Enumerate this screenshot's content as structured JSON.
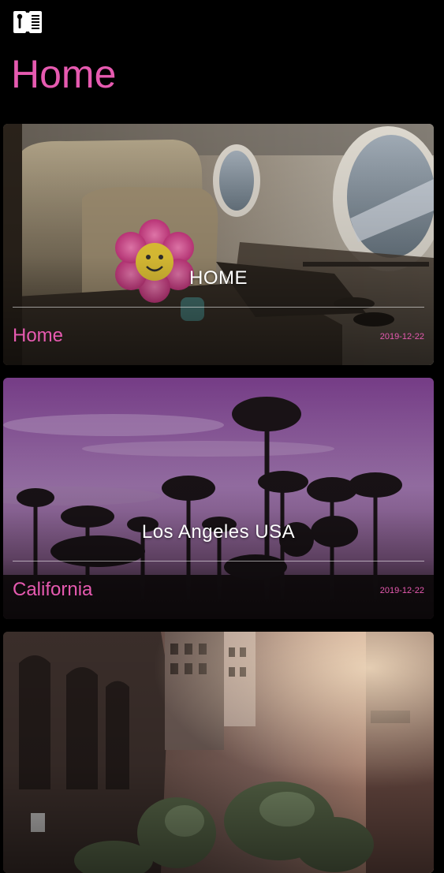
{
  "theme": {
    "accent": "#e65ab0",
    "background": "#000000"
  },
  "top_bar": {
    "menu_icon": "book-menu-icon"
  },
  "page": {
    "title": "Home"
  },
  "cards": [
    {
      "headline": "HOME",
      "category": "Home",
      "date": "2019-12-22",
      "image": "airplane-cabin-seat-with-flower-toy"
    },
    {
      "headline": "Los Angeles USA",
      "category": "California",
      "date": "2019-12-22",
      "image": "palm-trees-purple-sunset"
    },
    {
      "headline": "",
      "category": "",
      "date": "",
      "image": "city-street-buildings-sunlight"
    }
  ]
}
